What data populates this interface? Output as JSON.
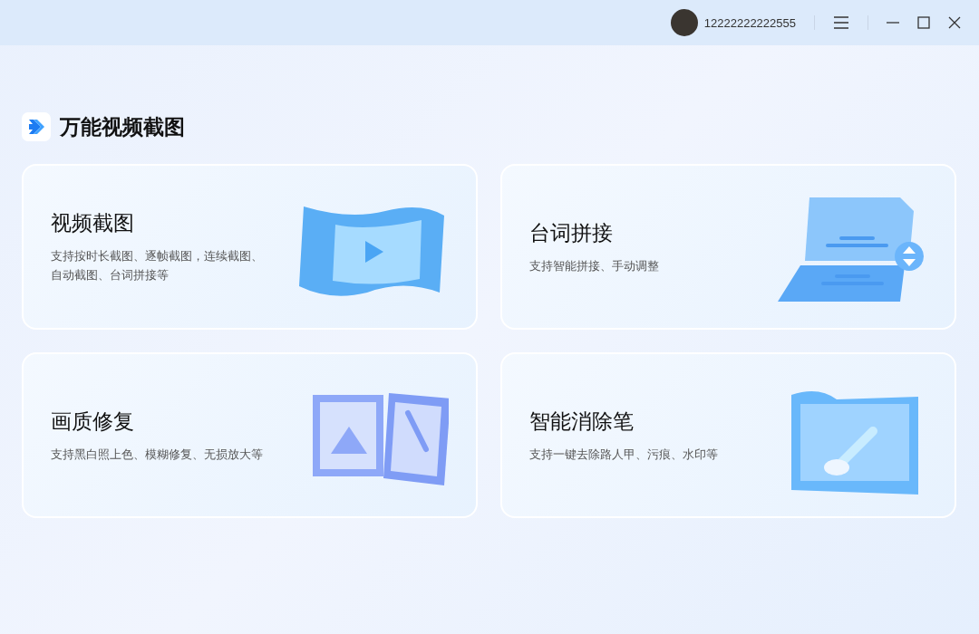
{
  "titlebar": {
    "username": "12222222222555"
  },
  "app": {
    "name": "万能视频截图"
  },
  "cards": [
    {
      "kind": "film",
      "title": "视频截图",
      "description": "支持按时长截图、逐帧截图，连续截图、自动截图、台词拼接等"
    },
    {
      "kind": "script",
      "title": "台词拼接",
      "description": "支持智能拼接、手动调整"
    },
    {
      "kind": "photo",
      "title": "画质修复",
      "description": "支持黑白照上色、模糊修复、无损放大等"
    },
    {
      "kind": "eraser",
      "title": "智能消除笔",
      "description": "支持一键去除路人甲、污痕、水印等"
    }
  ]
}
